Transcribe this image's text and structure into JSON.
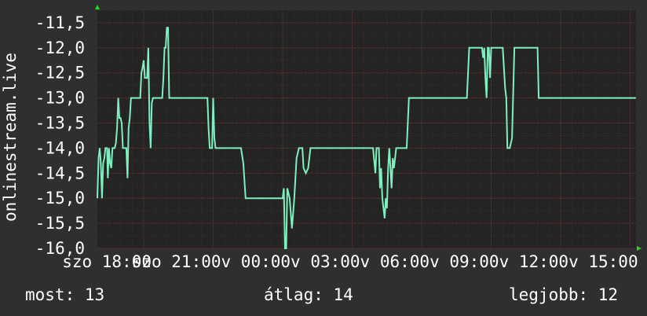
{
  "chart_data": {
    "type": "line",
    "ylabel": "onlinestream.live",
    "ylim": [
      -16.0,
      -11.25
    ],
    "yticks": [
      "-11,5",
      "-12,0",
      "-12,5",
      "-13,0",
      "-13,5",
      "-14,0",
      "-14,5",
      "-15,0",
      "-15,5",
      "-16,0"
    ],
    "ytick_values": [
      -11.5,
      -12.0,
      -12.5,
      -13.0,
      -13.5,
      -14.0,
      -14.5,
      -15.0,
      -15.5,
      -16.0
    ],
    "xlim": [
      16.0,
      39.25
    ],
    "xticks": [
      "szo 18:00",
      "szo 21:00",
      "v 00:00",
      "v 03:00",
      "v 06:00",
      "v 09:00",
      "v 12:00",
      "v 15:00"
    ],
    "xtick_values": [
      18,
      21,
      24,
      27,
      30,
      33,
      36,
      39
    ],
    "grid": true,
    "series": [
      {
        "color": "#7fefbf",
        "points": [
          [
            16.0,
            -15.0
          ],
          [
            16.05,
            -14.2
          ],
          [
            16.1,
            -14.0
          ],
          [
            16.15,
            -14.3
          ],
          [
            16.2,
            -15.0
          ],
          [
            16.25,
            -14.3
          ],
          [
            16.3,
            -14.2
          ],
          [
            16.35,
            -14.0
          ],
          [
            16.42,
            -14.0
          ],
          [
            16.45,
            -14.6
          ],
          [
            16.5,
            -14.0
          ],
          [
            16.55,
            -14.3
          ],
          [
            16.6,
            -14.4
          ],
          [
            16.65,
            -14.0
          ],
          [
            16.75,
            -14.0
          ],
          [
            16.8,
            -13.9
          ],
          [
            16.85,
            -13.6
          ],
          [
            16.9,
            -13.0
          ],
          [
            16.95,
            -13.4
          ],
          [
            17.0,
            -13.4
          ],
          [
            17.05,
            -13.5
          ],
          [
            17.1,
            -14.0
          ],
          [
            17.25,
            -14.0
          ],
          [
            17.3,
            -14.6
          ],
          [
            17.35,
            -13.6
          ],
          [
            17.4,
            -13.4
          ],
          [
            17.45,
            -13.0
          ],
          [
            17.85,
            -13.0
          ],
          [
            17.9,
            -12.5
          ],
          [
            17.95,
            -12.4
          ],
          [
            18.0,
            -12.25
          ],
          [
            18.05,
            -12.6
          ],
          [
            18.15,
            -12.6
          ],
          [
            18.2,
            -12.0
          ],
          [
            18.25,
            -13.5
          ],
          [
            18.3,
            -14.0
          ],
          [
            18.35,
            -13.1
          ],
          [
            18.4,
            -13.0
          ],
          [
            18.8,
            -13.0
          ],
          [
            18.85,
            -12.6
          ],
          [
            18.9,
            -12.0
          ],
          [
            18.95,
            -12.0
          ],
          [
            19.0,
            -11.6
          ],
          [
            19.05,
            -11.6
          ],
          [
            19.1,
            -13.0
          ],
          [
            20.75,
            -13.0
          ],
          [
            20.8,
            -13.6
          ],
          [
            20.85,
            -14.0
          ],
          [
            20.95,
            -14.0
          ],
          [
            21.0,
            -13.0
          ],
          [
            21.05,
            -13.8
          ],
          [
            21.1,
            -14.0
          ],
          [
            22.2,
            -14.0
          ],
          [
            22.3,
            -14.3
          ],
          [
            22.4,
            -15.0
          ],
          [
            24.0,
            -15.0
          ],
          [
            24.05,
            -14.8
          ],
          [
            24.1,
            -16.0
          ],
          [
            24.15,
            -16.0
          ],
          [
            24.2,
            -14.8
          ],
          [
            24.3,
            -15.0
          ],
          [
            24.4,
            -15.6
          ],
          [
            24.5,
            -15.0
          ],
          [
            24.6,
            -14.2
          ],
          [
            24.7,
            -14.0
          ],
          [
            24.85,
            -14.0
          ],
          [
            24.9,
            -14.4
          ],
          [
            25.0,
            -14.5
          ],
          [
            25.1,
            -14.4
          ],
          [
            25.2,
            -14.0
          ],
          [
            27.9,
            -14.0
          ],
          [
            28.0,
            -14.5
          ],
          [
            28.05,
            -14.0
          ],
          [
            28.15,
            -14.0
          ],
          [
            28.2,
            -14.8
          ],
          [
            28.25,
            -14.4
          ],
          [
            28.3,
            -15.0
          ],
          [
            28.4,
            -15.4
          ],
          [
            28.45,
            -15.0
          ],
          [
            28.5,
            -15.2
          ],
          [
            28.55,
            -14.4
          ],
          [
            28.6,
            -14.0
          ],
          [
            28.7,
            -14.8
          ],
          [
            28.75,
            -14.2
          ],
          [
            28.8,
            -14.4
          ],
          [
            28.9,
            -14.0
          ],
          [
            29.35,
            -14.0
          ],
          [
            29.4,
            -13.5
          ],
          [
            29.45,
            -13.0
          ],
          [
            31.95,
            -13.0
          ],
          [
            32.0,
            -12.5
          ],
          [
            32.05,
            -12.0
          ],
          [
            32.6,
            -12.0
          ],
          [
            32.65,
            -12.2
          ],
          [
            32.7,
            -12.0
          ],
          [
            32.75,
            -12.6
          ],
          [
            32.8,
            -13.0
          ],
          [
            32.85,
            -12.0
          ],
          [
            32.9,
            -12.0
          ],
          [
            32.95,
            -12.6
          ],
          [
            33.0,
            -12.0
          ],
          [
            33.5,
            -12.0
          ],
          [
            33.55,
            -12.4
          ],
          [
            33.6,
            -12.8
          ],
          [
            33.65,
            -13.0
          ],
          [
            33.7,
            -14.0
          ],
          [
            33.8,
            -14.0
          ],
          [
            33.9,
            -13.8
          ],
          [
            34.0,
            -12.0
          ],
          [
            35.0,
            -12.0
          ],
          [
            35.05,
            -13.0
          ],
          [
            35.15,
            -13.0
          ],
          [
            39.25,
            -13.0
          ]
        ]
      }
    ]
  },
  "footer": {
    "current": "most: 13",
    "average": "átlag: 14",
    "best": "legjobb: 12"
  },
  "colors": {
    "background": "#2f2f2f",
    "plot_background": "#242424",
    "grid": "#5a3535",
    "line": "#7fefbf",
    "axis_marker": "#22dd22",
    "text": "#ffffff"
  }
}
